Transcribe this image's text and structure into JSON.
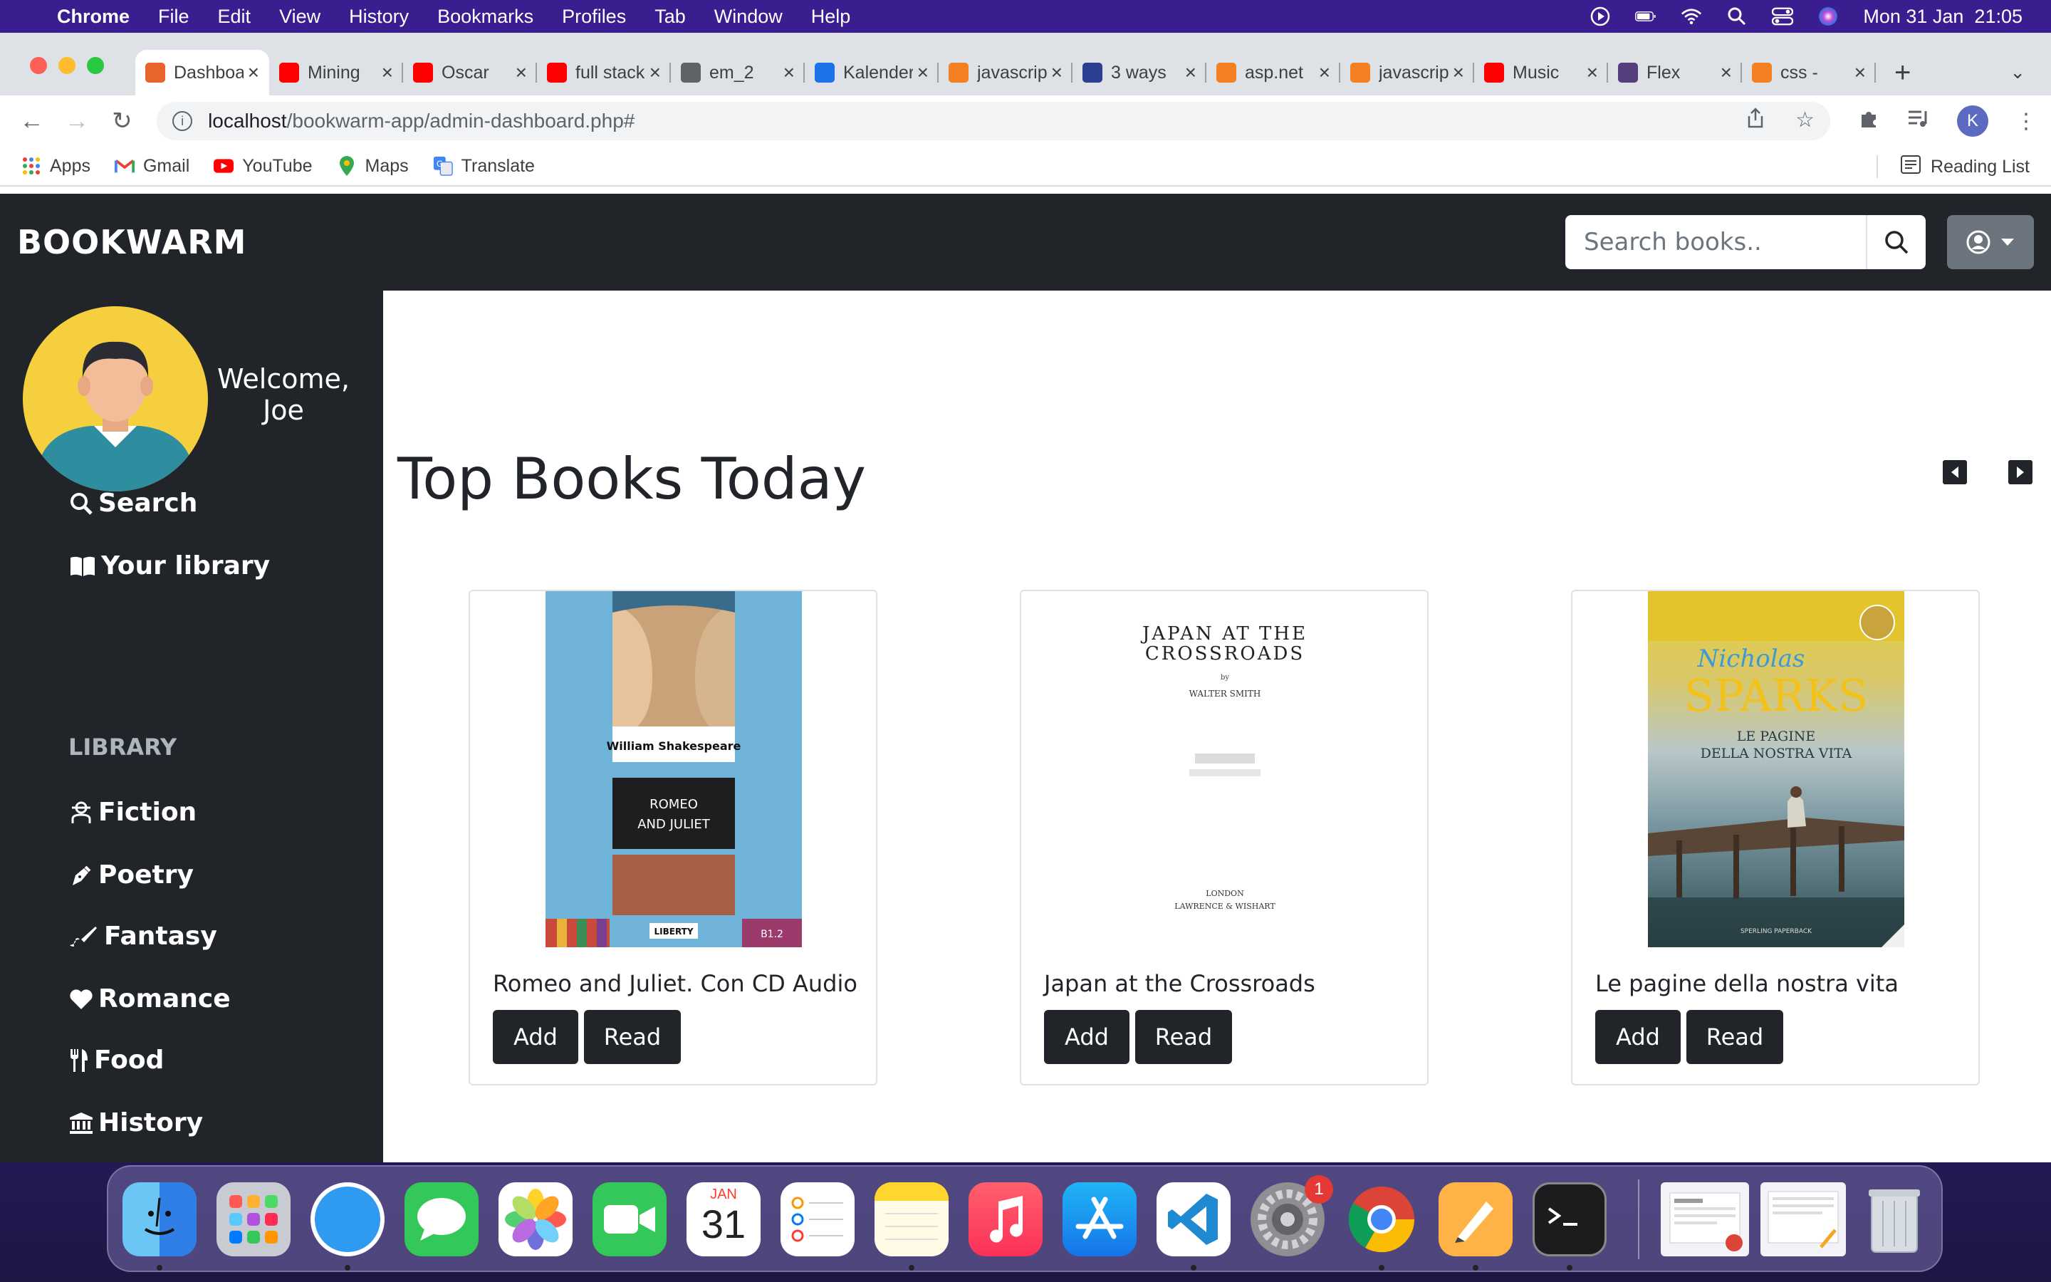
{
  "menubar": {
    "app": "Chrome",
    "items": [
      "File",
      "Edit",
      "View",
      "History",
      "Bookmarks",
      "Profiles",
      "Tab",
      "Window",
      "Help"
    ],
    "clock": "Mon 31 Jan  21:05"
  },
  "tabs": [
    {
      "title": "Dashboard",
      "icon": "bookwarm-favicon",
      "color": "#e8642c"
    },
    {
      "title": "Mining",
      "icon": "youtube-favicon",
      "color": "#ff0000"
    },
    {
      "title": "Oscar",
      "icon": "youtube-favicon",
      "color": "#ff0000"
    },
    {
      "title": "full stack",
      "icon": "youtube-favicon",
      "color": "#ff0000"
    },
    {
      "title": "em_2",
      "icon": "globe-favicon",
      "color": "#5f6368"
    },
    {
      "title": "Kalender",
      "icon": "calendar-favicon",
      "color": "#1a73e8"
    },
    {
      "title": "javascript",
      "icon": "stackoverflow-favicon",
      "color": "#f48024"
    },
    {
      "title": "3 ways",
      "icon": "codegrepper-favicon",
      "color": "#2c3e8f"
    },
    {
      "title": "asp.net",
      "icon": "stackoverflow-favicon",
      "color": "#f48024"
    },
    {
      "title": "javascript",
      "icon": "stackoverflow-favicon",
      "color": "#f48024"
    },
    {
      "title": "Music",
      "icon": "youtube-favicon",
      "color": "#ff0000"
    },
    {
      "title": "Flex",
      "icon": "bootstrap-favicon",
      "color": "#563d7c"
    },
    {
      "title": "css -",
      "icon": "stackoverflow-favicon",
      "color": "#f48024"
    }
  ],
  "address": {
    "host": "localhost",
    "path": "/bookwarm-app/admin-dashboard.php#"
  },
  "profile_initial": "K",
  "bookmarks": [
    "Apps",
    "Gmail",
    "YouTube",
    "Maps",
    "Translate"
  ],
  "reading_list": "Reading List",
  "app": {
    "brand": "BOOKWARM",
    "search_placeholder": "Search books..",
    "welcome": "Welcome, Joe",
    "nav": [
      {
        "label": "Search",
        "icon": "search-icon"
      },
      {
        "label": "Your library",
        "icon": "book-open-icon"
      }
    ],
    "library_heading": "LIBRARY",
    "genres": [
      {
        "label": "Fiction",
        "icon": "user-secret-icon"
      },
      {
        "label": "Poetry",
        "icon": "pen-nib-icon"
      },
      {
        "label": "Fantasy",
        "icon": "paint-brush-icon"
      },
      {
        "label": "Romance",
        "icon": "heart-icon"
      },
      {
        "label": "Food",
        "icon": "utensils-icon"
      },
      {
        "label": "History",
        "icon": "landmark-icon"
      }
    ],
    "section_title": "Top Books Today",
    "books": [
      {
        "title": "Romeo and Juliet. Con CD Audio",
        "add": "Add",
        "read": "Read",
        "cover_author": "William Shakespeare",
        "cover_title": "ROMEO AND JULIET",
        "cover_level": "B1.2",
        "cover_publisher": "LIBERTY"
      },
      {
        "title": "Japan at the Crossroads",
        "add": "Add",
        "read": "Read",
        "cover_title": "JAPAN AT THE CROSSROADS",
        "cover_author": "WALTER SMITH",
        "cover_place": "LONDON",
        "cover_publisher": "LAWRENCE & WISHART"
      },
      {
        "title": "Le pagine della nostra vita",
        "add": "Add",
        "read": "Read",
        "cover_author_first": "Nicholas",
        "cover_author_last": "SPARKS",
        "cover_subtitle": "LE PAGINE DELLA NOSTRA VITA",
        "cover_publisher": "SPERLING PAPERBACK"
      }
    ]
  },
  "dock": {
    "apps": [
      "Finder",
      "Launchpad",
      "Safari",
      "Messages",
      "Photos",
      "FaceTime",
      "Calendar",
      "Reminders",
      "Notes",
      "Music",
      "App Store",
      "Visual Studio Code",
      "System Preferences",
      "Chrome",
      "Pages",
      "Terminal",
      "Downloads",
      "Documents",
      "Trash"
    ],
    "calendar_month": "JAN",
    "calendar_day": "31",
    "badge": "1"
  }
}
